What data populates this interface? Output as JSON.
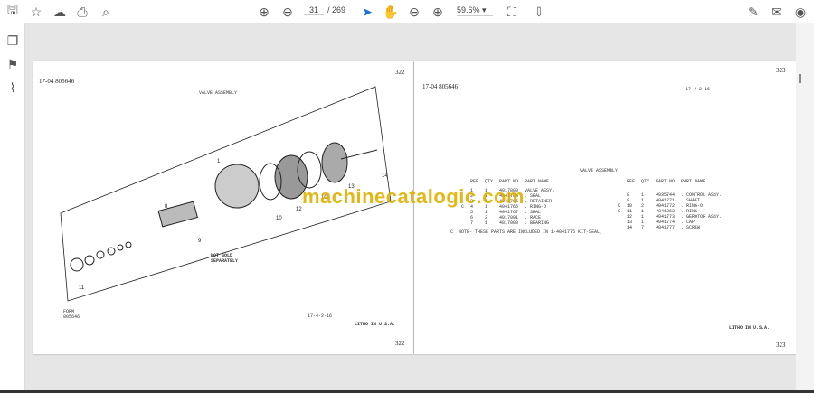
{
  "toolbar": {
    "icons": [
      "save-icon",
      "bookmark-star-icon",
      "upload-cloud-icon",
      "print-icon",
      "zoom-search-icon",
      "page-up-icon",
      "page-down-icon",
      "select-cursor-icon",
      "hand-icon",
      "zoom-out-icon",
      "zoom-in-icon",
      "fit-page-icon",
      "scroll-mode-icon",
      "sign-icon",
      "mail-icon",
      "account-icon"
    ],
    "current_page": "31",
    "total_pages": "/ 269",
    "zoom": "59.6%"
  },
  "sidebar": {
    "icons": [
      "pages-icon",
      "bookmarks-icon",
      "attachments-icon"
    ]
  },
  "left_page": {
    "number_top": "322",
    "number_bottom": "322",
    "header": "17-04  805646",
    "title": "VALVE ASSEMBLY",
    "not_sold": "NOT SOLD\nSEPARATELY",
    "form": "FORM\n805646",
    "code": "17-4-2-16",
    "litho": "LITHO IN U.S.A.",
    "callouts": [
      "1",
      "2",
      "3",
      "4",
      "5",
      "6",
      "7",
      "8",
      "9",
      "10",
      "11",
      "12",
      "13",
      "14"
    ]
  },
  "right_page": {
    "number_top": "323",
    "number_bottom": "323",
    "header": "17-04  805646",
    "code": "17-4-2-16",
    "title": "VALVE ASSEMBLY",
    "litho": "LITHO IN U.S.A.",
    "columns": [
      "REF",
      "QTY",
      "PART NO",
      "PART NAME"
    ],
    "rows_left": [
      [
        "",
        "1",
        "1",
        "4017808",
        "VALVE ASSY,"
      ],
      [
        "",
        "2",
        "1",
        "4041764",
        ". SEAL"
      ],
      [
        "",
        "3",
        "1",
        "4041765",
        ". RETAINER"
      ],
      [
        "C",
        "4",
        "1",
        "4041766",
        ". RING-O"
      ],
      [
        "",
        "5",
        "1",
        "4041767",
        ". SEAL"
      ],
      [
        "",
        "6",
        "2",
        "4017001",
        ". RACE"
      ],
      [
        "",
        "7",
        "1",
        "4017003",
        ". BEARING"
      ]
    ],
    "rows_right": [
      [
        "",
        "8",
        "1",
        "4035744",
        ". CONTROL ASSY."
      ],
      [
        "",
        "9",
        "1",
        "4041771",
        ". SHAFT"
      ],
      [
        "C",
        "10",
        "2",
        "4041772",
        ". RING-O"
      ],
      [
        "C",
        "11",
        "1",
        "4041363",
        ". RING"
      ],
      [
        "",
        "12",
        "1",
        "4041773",
        ". GEROTOR ASSY."
      ],
      [
        "",
        "13",
        "1",
        "4041774",
        ". CAP"
      ],
      [
        "",
        "14",
        "7",
        "4041777",
        ". SCREW"
      ]
    ],
    "note": "C  NOTE- THESE PARTS ARE INCLUDED IN 1-4041776 KIT-SEAL,"
  },
  "watermark": "machinecatalogic.com"
}
